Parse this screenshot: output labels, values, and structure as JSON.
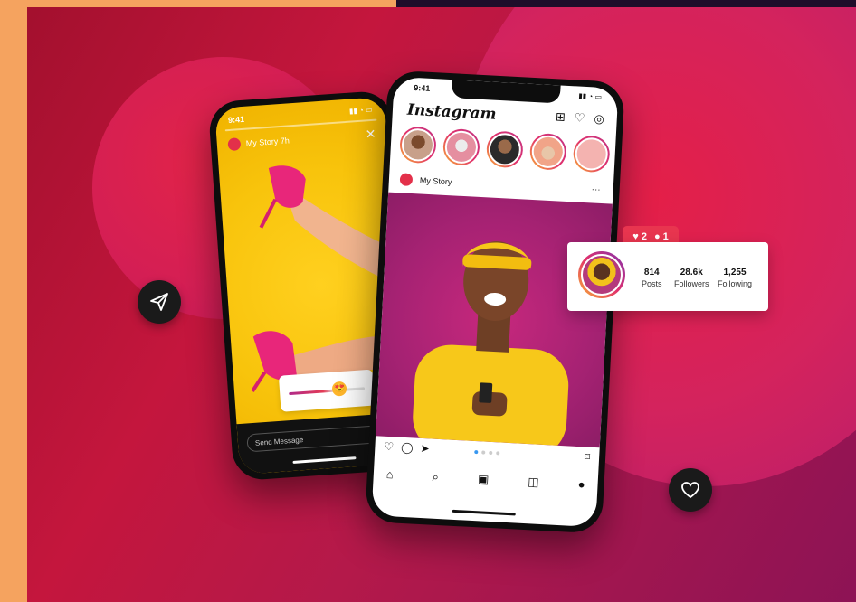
{
  "story_phone": {
    "time": "9:41",
    "user_label": "My Story  7h",
    "send_message_placeholder": "Send Message"
  },
  "feed_phone": {
    "time": "9:41",
    "app_title": "Instagram",
    "post_user": "My Story",
    "nav_icons": [
      "home-icon",
      "search-icon",
      "reels-icon",
      "shop-icon",
      "profile-icon"
    ]
  },
  "profile_card": {
    "posts_value": "814",
    "posts_label": "Posts",
    "followers_value": "28.6k",
    "followers_label": "Followers",
    "following_value": "1,255",
    "following_label": "Following"
  },
  "notification": {
    "likes": "2",
    "comments": "1"
  },
  "colors": {
    "background": "#c4163d",
    "accent": "#e8354f",
    "story_bg": "#f8c40c",
    "frame_left": "#f5a35f"
  }
}
